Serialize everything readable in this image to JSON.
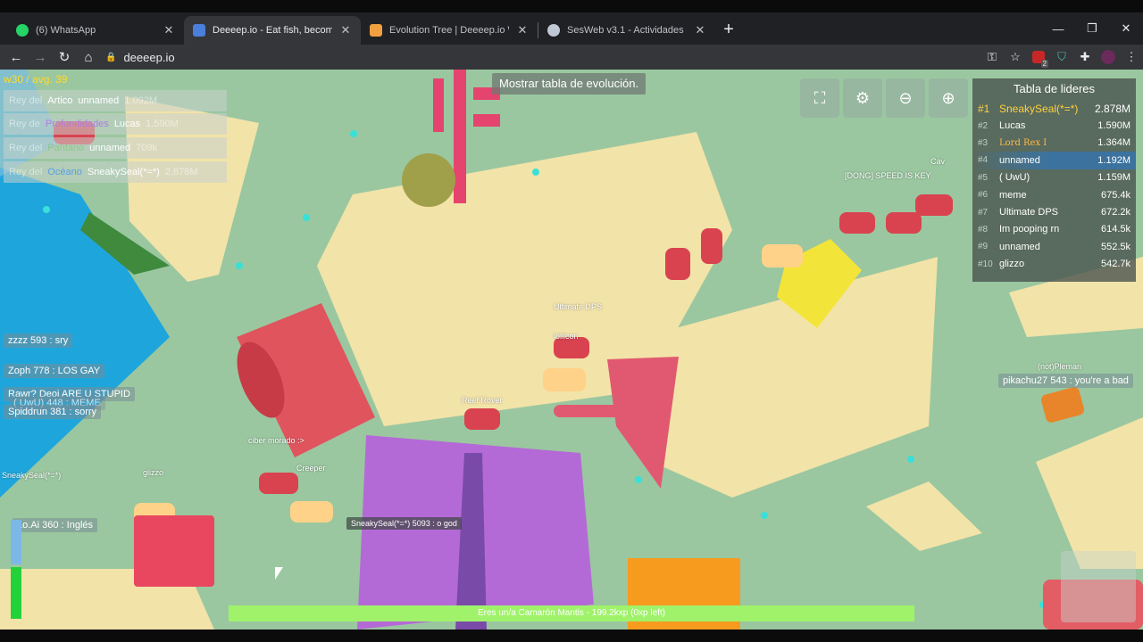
{
  "browser": {
    "tabs": [
      {
        "title": "(6) WhatsApp",
        "color": "#25d366",
        "active": false
      },
      {
        "title": "Deeeep.io - Eat fish, become the",
        "color": "#4a7fdc",
        "active": true
      },
      {
        "title": "Evolution Tree | Deeeep.io Wiki |",
        "color": "#f0a040",
        "active": false
      },
      {
        "title": "SesWeb v3.1 - Actividades",
        "color": "#c0c8d4",
        "active": false
      }
    ],
    "url": "deeeep.io",
    "abp_badge": "2"
  },
  "game": {
    "stats_text": "w30 / avg. 39",
    "evolution_button": "Mostrar tabla de evolución.",
    "leaderboard": {
      "title": "Tabla de lideres",
      "rows": [
        {
          "rank": "#1",
          "name": "SneakySeal(*=*)",
          "score": "2.878M"
        },
        {
          "rank": "#2",
          "name": "Lucas",
          "score": "1.590M"
        },
        {
          "rank": "#3",
          "name": "Lord Rex I",
          "score": "1.364M"
        },
        {
          "rank": "#4",
          "name": "unnamed",
          "score": "1.192M"
        },
        {
          "rank": "#5",
          "name": "( UwU)",
          "score": "1.159M"
        },
        {
          "rank": "#6",
          "name": "meme",
          "score": "675.4k"
        },
        {
          "rank": "#7",
          "name": "Ultimate DPS",
          "score": "672.2k"
        },
        {
          "rank": "#8",
          "name": "Im pooping rn",
          "score": "614.5k"
        },
        {
          "rank": "#9",
          "name": "unnamed",
          "score": "552.5k"
        },
        {
          "rank": "#10",
          "name": "glizzo",
          "score": "542.7k"
        }
      ]
    },
    "killfeed": [
      {
        "a": "Rey del",
        "b": "Artico",
        "c": "unnamed",
        "d": "1.092M"
      },
      {
        "a": "Rey de",
        "b": "Profundidades",
        "c": "Lucas",
        "d": "1.590M"
      },
      {
        "a": "Rey del",
        "b": "Pantano",
        "c": "unnamed",
        "d": "709k"
      },
      {
        "a": "Rey del",
        "b": "Océano",
        "c": "SneakySeal(*=*)",
        "d": "2.878M"
      }
    ],
    "chat": [
      {
        "text": "zzzz 593 : sry"
      },
      {
        "text": "Zoph 778 : LOS GAY"
      },
      {
        "text": "Rawr? Deoi ARE U STUPID"
      },
      {
        "text": "( UwU) 448 : MEME"
      },
      {
        "text": "Spiddrun 381 : sorry"
      },
      {
        "text": "pikachu27 543 : you're a bad"
      },
      {
        "text": "Lo.Ai 360 : Inglés"
      },
      {
        "text": "SneakySeal(*=*) 5093 : o god"
      }
    ],
    "player_labels": [
      "[DONG] SPEED IS KEY",
      "Cav",
      "Ultimate DPS",
      "lollicon",
      "Reef Rover",
      "ciber morado :>",
      "Creeper",
      "glizzo",
      "SneakySeal(*=*)",
      "(not)Pleman"
    ],
    "xp": {
      "text": "Eres un/a Camarón Mantis - 199.2kxp (0xp left)",
      "fraction": 1.0
    }
  }
}
